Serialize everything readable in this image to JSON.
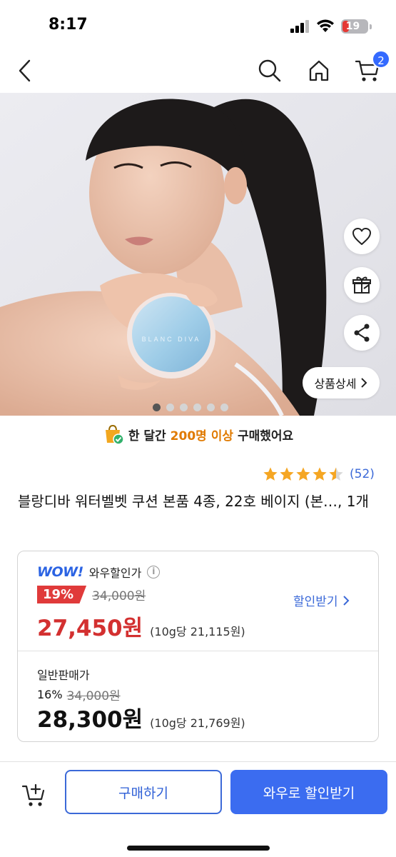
{
  "status_bar": {
    "time": "8:17",
    "battery_level": "19"
  },
  "nav": {
    "cart_count": "2"
  },
  "hero": {
    "compact_text": "BLANC DIVA",
    "detail_button_label": "상품상세",
    "image_count": 6,
    "active_index": 0
  },
  "purchase_note": {
    "prefix": "한 달간",
    "highlight": "200명 이상",
    "suffix": "구매했어요"
  },
  "rating": {
    "stars": 4.5,
    "review_count": "(52)"
  },
  "product": {
    "title": "블랑디바 워터벨벳 쿠션 본품 4종, 22호 베이지 (본…, 1개"
  },
  "wow_price": {
    "logo": "WOW!",
    "label": "와우할인가",
    "info": "i",
    "discount": "19%",
    "original": "34,000원",
    "coupon_link": "할인받기",
    "price": "27,450원",
    "unit": "(10g당 21,115원)"
  },
  "normal_price": {
    "label": "일반판매가",
    "discount": "16%",
    "original": "34,000원",
    "price": "28,300원",
    "unit": "(10g당 21,769원)"
  },
  "bottom_bar": {
    "buy_label": "구매하기",
    "wow_label": "와우로 할인받기"
  },
  "colors": {
    "accent_blue": "#3b6cf0",
    "discount_red": "#d33030",
    "star_gold": "#f5a623",
    "highlight_orange": "#e07a00"
  }
}
